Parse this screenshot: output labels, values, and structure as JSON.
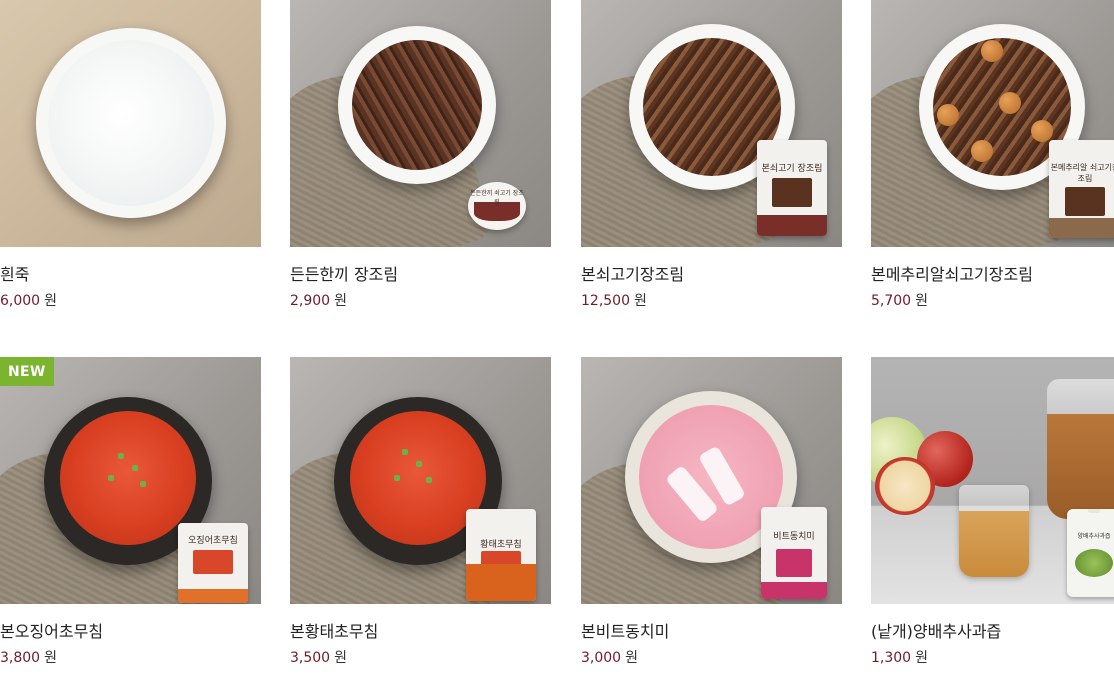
{
  "products": [
    {
      "name": "흰죽",
      "price": "6,000",
      "currency": "원",
      "badge": ""
    },
    {
      "name": "든든한끼 장조림",
      "price": "2,900",
      "currency": "원",
      "badge": "",
      "package_text": "든든한끼 쇠고기 장조림"
    },
    {
      "name": "본쇠고기장조림",
      "price": "12,500",
      "currency": "원",
      "badge": "",
      "package_text": "본쇠고기 장조림"
    },
    {
      "name": "본메추리알쇠고기장조림",
      "price": "5,700",
      "currency": "원",
      "badge": "",
      "package_text": "본메추리알 쇠고기장조림"
    },
    {
      "name": "본오징어초무침",
      "price": "3,800",
      "currency": "원",
      "badge": "NEW",
      "package_text": "오징어초무침"
    },
    {
      "name": "본황태초무침",
      "price": "3,500",
      "currency": "원",
      "badge": "",
      "package_text": "황태초무침"
    },
    {
      "name": "본비트동치미",
      "price": "3,000",
      "currency": "원",
      "badge": "",
      "package_text": "비트동치미"
    },
    {
      "name": "(낱개)양배추사과즙",
      "price": "1,300",
      "currency": "원",
      "badge": "",
      "package_text": "양배추사과즙"
    }
  ],
  "colors": {
    "price": "#6f1c2a",
    "badge": "#7bb52f",
    "name": "#222222"
  },
  "icons": {
    "badge": "new-badge"
  }
}
